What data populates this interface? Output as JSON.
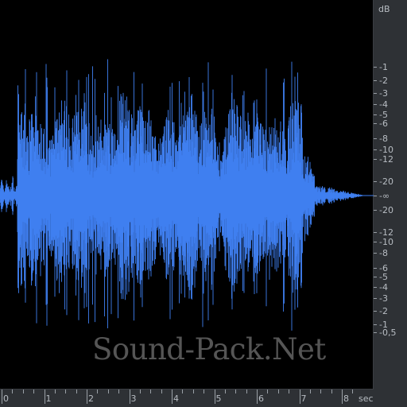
{
  "colors": {
    "wave": "#3f7ff0",
    "background": "#000000",
    "ruler": "#2e3135"
  },
  "db_ruler": {
    "unit": "dB",
    "ticks": [
      {
        "label": "-1",
        "v": 0.891
      },
      {
        "label": "-2",
        "v": 0.794
      },
      {
        "label": "-3",
        "v": 0.708
      },
      {
        "label": "-4",
        "v": 0.631
      },
      {
        "label": "-5",
        "v": 0.562
      },
      {
        "label": "-6",
        "v": 0.501
      },
      {
        "label": "-8",
        "v": 0.398
      },
      {
        "label": "-10",
        "v": 0.316
      },
      {
        "label": "-12",
        "v": 0.251
      },
      {
        "label": "-20",
        "v": 0.1
      },
      {
        "label": "-∞",
        "v": 0
      },
      {
        "label": "-20",
        "v": -0.1
      },
      {
        "label": "-12",
        "v": -0.251
      },
      {
        "label": "-10",
        "v": -0.316
      },
      {
        "label": "-8",
        "v": -0.398
      },
      {
        "label": "-6",
        "v": -0.501
      },
      {
        "label": "-5",
        "v": -0.562
      },
      {
        "label": "-4",
        "v": -0.631
      },
      {
        "label": "-3",
        "v": -0.708
      },
      {
        "label": "-2",
        "v": -0.794
      },
      {
        "label": "-1",
        "v": -0.891
      },
      {
        "label": "-0,5",
        "v": -0.944
      }
    ]
  },
  "time_ruler": {
    "unit": "sec",
    "labels": [
      "0",
      "1",
      "2",
      "3",
      "4",
      "5",
      "6",
      "7",
      "8"
    ]
  },
  "waveform": {
    "duration_sec": 8.8,
    "signal_end_sec": 7.9
  },
  "watermark": "Sound-Pack.Net"
}
